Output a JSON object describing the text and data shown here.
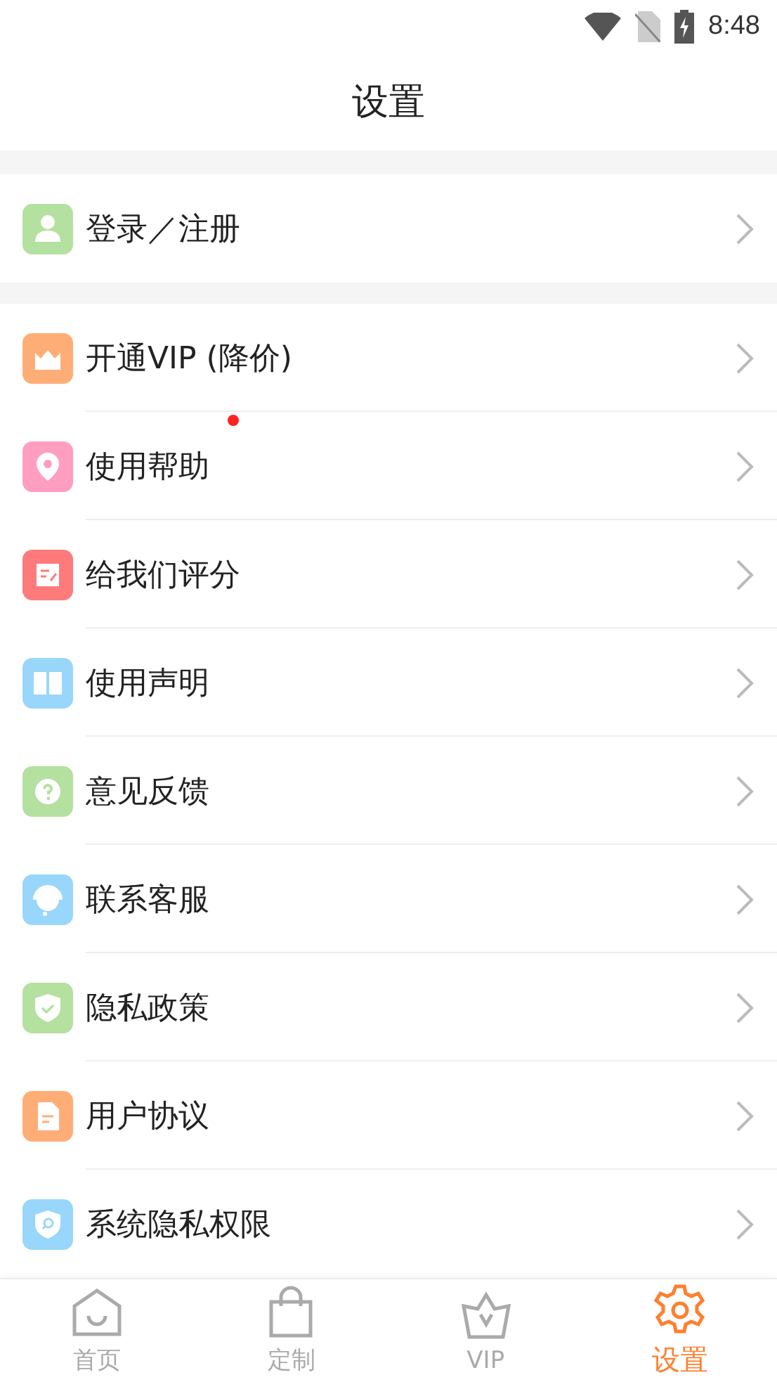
{
  "status_bar": {
    "time": "8:48"
  },
  "title": "设置",
  "sections": [
    {
      "items": [
        {
          "label": "登录／注册",
          "kind": "user",
          "color": "#b4e0a0",
          "dot": false
        }
      ]
    },
    {
      "items": [
        {
          "label": "开通VIP (降价)",
          "kind": "crown",
          "color": "#ffad76",
          "dot": false
        },
        {
          "label": "使用帮助",
          "kind": "pin",
          "color": "#ff9ec0",
          "dot": true
        },
        {
          "label": "给我们评分",
          "kind": "note",
          "color": "#ff7a7a",
          "dot": false
        },
        {
          "label": "使用声明",
          "kind": "book",
          "color": "#98d6fb",
          "dot": false
        },
        {
          "label": "意见反馈",
          "kind": "question",
          "color": "#b4e0a0",
          "dot": false
        },
        {
          "label": "联系客服",
          "kind": "headset",
          "color": "#98d6fb",
          "dot": false
        },
        {
          "label": "隐私政策",
          "kind": "shield",
          "color": "#b4e0a0",
          "dot": false
        },
        {
          "label": "用户协议",
          "kind": "doc",
          "color": "#ffad76",
          "dot": false
        },
        {
          "label": "系统隐私权限",
          "kind": "search-shield",
          "color": "#98d6fb",
          "dot": false
        }
      ]
    }
  ],
  "tabs": [
    {
      "label": "首页",
      "kind": "home",
      "selected": false
    },
    {
      "label": "定制",
      "kind": "bag",
      "selected": false
    },
    {
      "label": "VIP",
      "kind": "crown",
      "selected": false
    },
    {
      "label": "设置",
      "kind": "gear",
      "selected": true
    }
  ]
}
